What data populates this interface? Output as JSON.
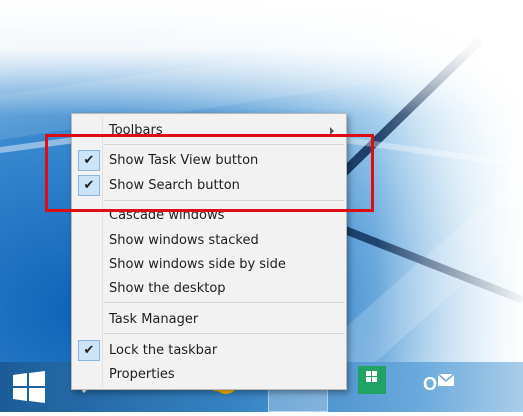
{
  "context_menu": {
    "items": [
      {
        "label": "Toolbars",
        "checked": false,
        "submenu": true
      },
      {
        "label": "Show Task View button",
        "checked": true
      },
      {
        "label": "Show Search button",
        "checked": true
      },
      {
        "label": "Cascade windows",
        "checked": false
      },
      {
        "label": "Show windows stacked",
        "checked": false
      },
      {
        "label": "Show windows side by side",
        "checked": false
      },
      {
        "label": "Show the desktop",
        "checked": false
      },
      {
        "label": "Task Manager",
        "checked": false
      },
      {
        "label": "Lock the taskbar",
        "checked": true
      },
      {
        "label": "Properties",
        "checked": false
      }
    ],
    "check_glyph": "✔"
  },
  "taskbar": {
    "buttons": [
      {
        "icon": "windows-logo-icon"
      },
      {
        "icon": "search-icon"
      },
      {
        "icon": "task-view-icon"
      },
      {
        "icon": "internet-explorer-icon"
      },
      {
        "icon": "file-explorer-icon"
      },
      {
        "icon": "store-icon"
      },
      {
        "icon": "outlook-icon",
        "label": "O"
      }
    ]
  },
  "colors": {
    "highlight_box": "#dd0d14",
    "menu_background": "#f2f2f2",
    "check_background": "#cce4f7",
    "taskbar_left": "#1b5c98",
    "taskbar_right": "#a9cde9"
  }
}
